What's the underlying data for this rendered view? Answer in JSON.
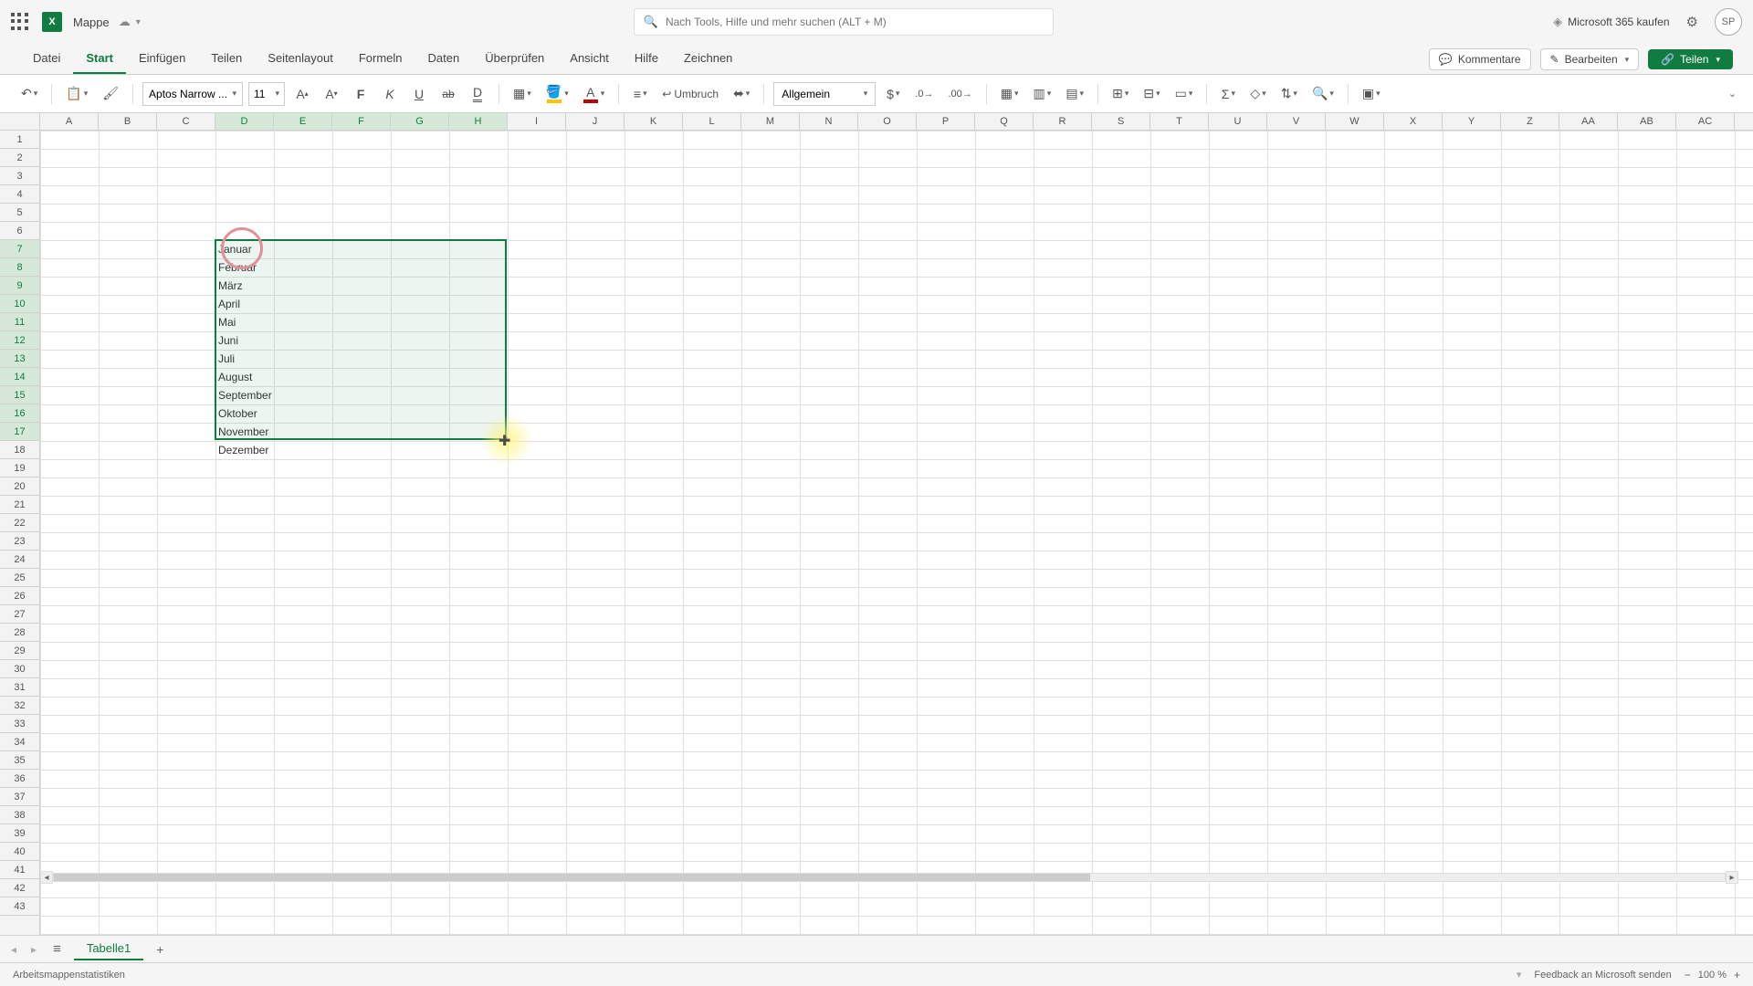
{
  "title_bar": {
    "doc_name": "Mappe",
    "search_placeholder": "Nach Tools, Hilfe und mehr suchen (ALT + M)",
    "buy_label": "Microsoft 365 kaufen",
    "avatar_initials": "SP"
  },
  "tabs": {
    "items": [
      "Datei",
      "Start",
      "Einfügen",
      "Teilen",
      "Seitenlayout",
      "Formeln",
      "Daten",
      "Überprüfen",
      "Ansicht",
      "Hilfe",
      "Zeichnen"
    ],
    "active_index": 1,
    "comments_label": "Kommentare",
    "edit_label": "Bearbeiten",
    "share_label": "Teilen"
  },
  "ribbon": {
    "font_name": "Aptos Narrow ...",
    "font_size": "11",
    "wrap_label": "Umbruch",
    "number_format": "Allgemein"
  },
  "columns": [
    "A",
    "B",
    "C",
    "D",
    "E",
    "F",
    "G",
    "H",
    "I",
    "J",
    "K",
    "L",
    "M",
    "N",
    "O",
    "P",
    "Q",
    "R",
    "S",
    "T",
    "U",
    "V",
    "W",
    "X",
    "Y",
    "Z",
    "AA",
    "AB",
    "AC"
  ],
  "selected_columns": [
    "D",
    "E",
    "F",
    "G",
    "H"
  ],
  "row_count": 43,
  "selected_rows_start": 7,
  "selected_rows_end": 17,
  "cell_data": {
    "D7": "Januar",
    "D8": "Februar",
    "D9": "März",
    "D10": "April",
    "D11": "Mai",
    "D12": "Juni",
    "D13": "Juli",
    "D14": "August",
    "D15": "September",
    "D16": "Oktober",
    "D17": "November",
    "D18": "Dezember"
  },
  "sheet_tabs": {
    "active": "Tabelle1"
  },
  "status": {
    "left_text": "Arbeitsmappenstatistiken",
    "feedback_label": "Feedback an Microsoft senden",
    "zoom": "100 %"
  }
}
